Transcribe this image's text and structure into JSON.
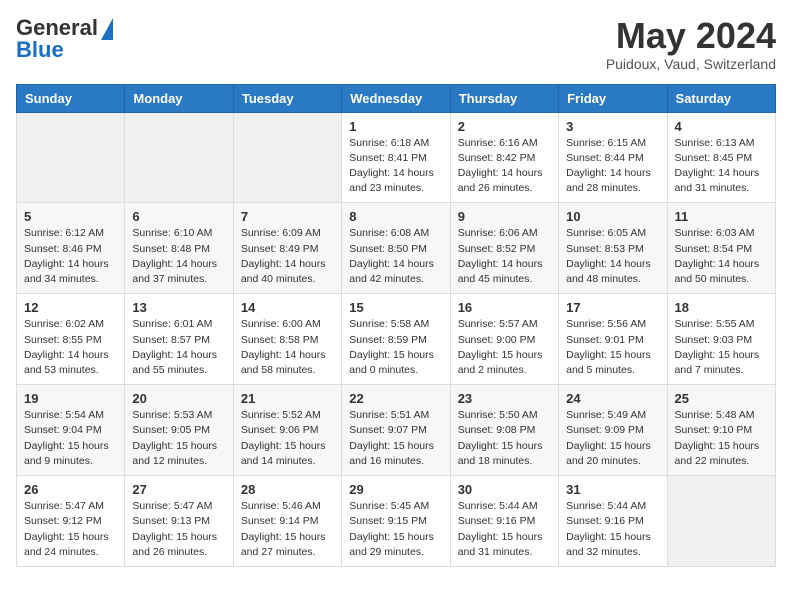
{
  "header": {
    "logo_general": "General",
    "logo_blue": "Blue",
    "month": "May 2024",
    "location": "Puidoux, Vaud, Switzerland"
  },
  "days_of_week": [
    "Sunday",
    "Monday",
    "Tuesday",
    "Wednesday",
    "Thursday",
    "Friday",
    "Saturday"
  ],
  "weeks": [
    {
      "days": [
        {
          "num": "",
          "sunrise": "",
          "sunset": "",
          "daylight": "",
          "empty": true
        },
        {
          "num": "",
          "sunrise": "",
          "sunset": "",
          "daylight": "",
          "empty": true
        },
        {
          "num": "",
          "sunrise": "",
          "sunset": "",
          "daylight": "",
          "empty": true
        },
        {
          "num": "1",
          "sunrise": "Sunrise: 6:18 AM",
          "sunset": "Sunset: 8:41 PM",
          "daylight": "Daylight: 14 hours and 23 minutes.",
          "empty": false
        },
        {
          "num": "2",
          "sunrise": "Sunrise: 6:16 AM",
          "sunset": "Sunset: 8:42 PM",
          "daylight": "Daylight: 14 hours and 26 minutes.",
          "empty": false
        },
        {
          "num": "3",
          "sunrise": "Sunrise: 6:15 AM",
          "sunset": "Sunset: 8:44 PM",
          "daylight": "Daylight: 14 hours and 28 minutes.",
          "empty": false
        },
        {
          "num": "4",
          "sunrise": "Sunrise: 6:13 AM",
          "sunset": "Sunset: 8:45 PM",
          "daylight": "Daylight: 14 hours and 31 minutes.",
          "empty": false
        }
      ]
    },
    {
      "days": [
        {
          "num": "5",
          "sunrise": "Sunrise: 6:12 AM",
          "sunset": "Sunset: 8:46 PM",
          "daylight": "Daylight: 14 hours and 34 minutes.",
          "empty": false
        },
        {
          "num": "6",
          "sunrise": "Sunrise: 6:10 AM",
          "sunset": "Sunset: 8:48 PM",
          "daylight": "Daylight: 14 hours and 37 minutes.",
          "empty": false
        },
        {
          "num": "7",
          "sunrise": "Sunrise: 6:09 AM",
          "sunset": "Sunset: 8:49 PM",
          "daylight": "Daylight: 14 hours and 40 minutes.",
          "empty": false
        },
        {
          "num": "8",
          "sunrise": "Sunrise: 6:08 AM",
          "sunset": "Sunset: 8:50 PM",
          "daylight": "Daylight: 14 hours and 42 minutes.",
          "empty": false
        },
        {
          "num": "9",
          "sunrise": "Sunrise: 6:06 AM",
          "sunset": "Sunset: 8:52 PM",
          "daylight": "Daylight: 14 hours and 45 minutes.",
          "empty": false
        },
        {
          "num": "10",
          "sunrise": "Sunrise: 6:05 AM",
          "sunset": "Sunset: 8:53 PM",
          "daylight": "Daylight: 14 hours and 48 minutes.",
          "empty": false
        },
        {
          "num": "11",
          "sunrise": "Sunrise: 6:03 AM",
          "sunset": "Sunset: 8:54 PM",
          "daylight": "Daylight: 14 hours and 50 minutes.",
          "empty": false
        }
      ]
    },
    {
      "days": [
        {
          "num": "12",
          "sunrise": "Sunrise: 6:02 AM",
          "sunset": "Sunset: 8:55 PM",
          "daylight": "Daylight: 14 hours and 53 minutes.",
          "empty": false
        },
        {
          "num": "13",
          "sunrise": "Sunrise: 6:01 AM",
          "sunset": "Sunset: 8:57 PM",
          "daylight": "Daylight: 14 hours and 55 minutes.",
          "empty": false
        },
        {
          "num": "14",
          "sunrise": "Sunrise: 6:00 AM",
          "sunset": "Sunset: 8:58 PM",
          "daylight": "Daylight: 14 hours and 58 minutes.",
          "empty": false
        },
        {
          "num": "15",
          "sunrise": "Sunrise: 5:58 AM",
          "sunset": "Sunset: 8:59 PM",
          "daylight": "Daylight: 15 hours and 0 minutes.",
          "empty": false
        },
        {
          "num": "16",
          "sunrise": "Sunrise: 5:57 AM",
          "sunset": "Sunset: 9:00 PM",
          "daylight": "Daylight: 15 hours and 2 minutes.",
          "empty": false
        },
        {
          "num": "17",
          "sunrise": "Sunrise: 5:56 AM",
          "sunset": "Sunset: 9:01 PM",
          "daylight": "Daylight: 15 hours and 5 minutes.",
          "empty": false
        },
        {
          "num": "18",
          "sunrise": "Sunrise: 5:55 AM",
          "sunset": "Sunset: 9:03 PM",
          "daylight": "Daylight: 15 hours and 7 minutes.",
          "empty": false
        }
      ]
    },
    {
      "days": [
        {
          "num": "19",
          "sunrise": "Sunrise: 5:54 AM",
          "sunset": "Sunset: 9:04 PM",
          "daylight": "Daylight: 15 hours and 9 minutes.",
          "empty": false
        },
        {
          "num": "20",
          "sunrise": "Sunrise: 5:53 AM",
          "sunset": "Sunset: 9:05 PM",
          "daylight": "Daylight: 15 hours and 12 minutes.",
          "empty": false
        },
        {
          "num": "21",
          "sunrise": "Sunrise: 5:52 AM",
          "sunset": "Sunset: 9:06 PM",
          "daylight": "Daylight: 15 hours and 14 minutes.",
          "empty": false
        },
        {
          "num": "22",
          "sunrise": "Sunrise: 5:51 AM",
          "sunset": "Sunset: 9:07 PM",
          "daylight": "Daylight: 15 hours and 16 minutes.",
          "empty": false
        },
        {
          "num": "23",
          "sunrise": "Sunrise: 5:50 AM",
          "sunset": "Sunset: 9:08 PM",
          "daylight": "Daylight: 15 hours and 18 minutes.",
          "empty": false
        },
        {
          "num": "24",
          "sunrise": "Sunrise: 5:49 AM",
          "sunset": "Sunset: 9:09 PM",
          "daylight": "Daylight: 15 hours and 20 minutes.",
          "empty": false
        },
        {
          "num": "25",
          "sunrise": "Sunrise: 5:48 AM",
          "sunset": "Sunset: 9:10 PM",
          "daylight": "Daylight: 15 hours and 22 minutes.",
          "empty": false
        }
      ]
    },
    {
      "days": [
        {
          "num": "26",
          "sunrise": "Sunrise: 5:47 AM",
          "sunset": "Sunset: 9:12 PM",
          "daylight": "Daylight: 15 hours and 24 minutes.",
          "empty": false
        },
        {
          "num": "27",
          "sunrise": "Sunrise: 5:47 AM",
          "sunset": "Sunset: 9:13 PM",
          "daylight": "Daylight: 15 hours and 26 minutes.",
          "empty": false
        },
        {
          "num": "28",
          "sunrise": "Sunrise: 5:46 AM",
          "sunset": "Sunset: 9:14 PM",
          "daylight": "Daylight: 15 hours and 27 minutes.",
          "empty": false
        },
        {
          "num": "29",
          "sunrise": "Sunrise: 5:45 AM",
          "sunset": "Sunset: 9:15 PM",
          "daylight": "Daylight: 15 hours and 29 minutes.",
          "empty": false
        },
        {
          "num": "30",
          "sunrise": "Sunrise: 5:44 AM",
          "sunset": "Sunset: 9:16 PM",
          "daylight": "Daylight: 15 hours and 31 minutes.",
          "empty": false
        },
        {
          "num": "31",
          "sunrise": "Sunrise: 5:44 AM",
          "sunset": "Sunset: 9:16 PM",
          "daylight": "Daylight: 15 hours and 32 minutes.",
          "empty": false
        },
        {
          "num": "",
          "sunrise": "",
          "sunset": "",
          "daylight": "",
          "empty": true
        }
      ]
    }
  ]
}
